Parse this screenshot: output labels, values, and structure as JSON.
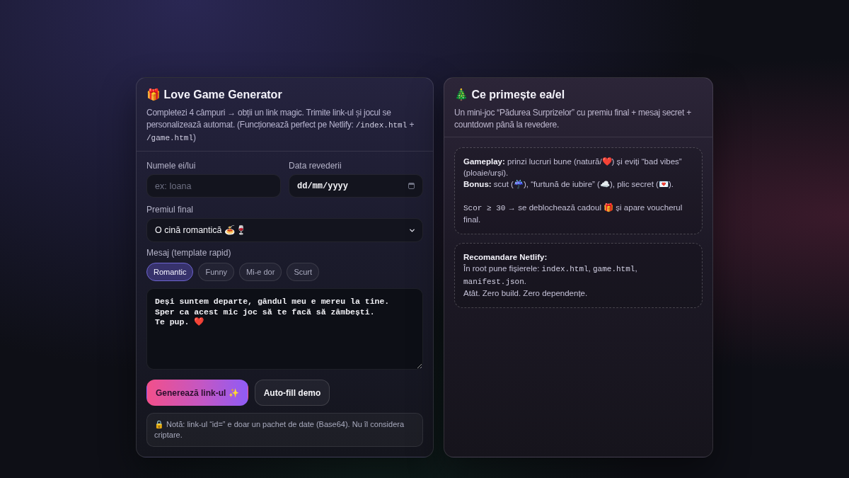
{
  "builder": {
    "title": "🎁 Love Game Generator",
    "description": [
      {
        "kind": "text",
        "text": "Completezi 4 câmpuri → obții un link magic. Trimite link-ul și jocul se personalizează automat. (Funcționează perfect pe Netlify: "
      },
      {
        "kind": "code",
        "text": "/index.html"
      },
      {
        "kind": "text",
        "text": " + "
      },
      {
        "kind": "code",
        "text": "/game.html"
      },
      {
        "kind": "text",
        "text": ")"
      }
    ],
    "fields": [
      {
        "kind": "text",
        "label": "Numele ei/lui",
        "placeholder": "ex: Ioana"
      },
      {
        "kind": "date",
        "label": "Data revederii",
        "value": "dd/mm/yyyy"
      }
    ],
    "prize": {
      "label": "Premiul final",
      "value": "O cină romantică 🍝🍷"
    },
    "templates": {
      "label": "Mesaj (template rapid)",
      "chips": [
        {
          "label": "Romantic",
          "selected": true
        },
        {
          "label": "Funny",
          "selected": false
        },
        {
          "label": "Mi-e dor",
          "selected": false
        },
        {
          "label": "Scurt",
          "selected": false
        }
      ]
    },
    "message": {
      "value": "Deși suntem departe, gândul meu e mereu la tine.\nSper ca acest mic joc să te facă să zâmbești.\nTe pup. ❤️"
    },
    "buttons": [
      {
        "kind": "primary",
        "label": "Generează link-ul ✨"
      },
      {
        "kind": "secondary",
        "label": "Auto-fill demo"
      }
    ],
    "note": "🔒 Notă: link-ul “id=” e doar un pachet de date (Base64). Nu îl considera criptare."
  },
  "summary": {
    "title": "🎄 Ce primește ea/el",
    "description": "Un mini-joc “Pădurea Surprizelor” cu premiu final + mesaj secret + countdown până la revedere.",
    "boxes": [
      {
        "sections": [
          [
            [
              {
                "kind": "bold",
                "text": "Gameplay:"
              },
              {
                "kind": "text",
                "text": " prinzi lucruri bune (natură/❤️) și eviți “bad vibes” (ploaie/urși)."
              }
            ],
            [
              {
                "kind": "bold",
                "text": "Bonus:"
              },
              {
                "kind": "text",
                "text": " scut (☔), “furtună de iubire” (☁️), plic secret (💌)."
              }
            ]
          ],
          [
            [
              {
                "kind": "code",
                "text": "Scor ≥ 30"
              },
              {
                "kind": "text",
                "text": " → se deblochează cadoul 🎁 și apare voucherul final."
              }
            ]
          ]
        ]
      },
      {
        "sections": [
          [
            [
              {
                "kind": "bold",
                "text": "Recomandare Netlify:"
              }
            ],
            [
              {
                "kind": "text",
                "text": "În root pune fișierele: "
              },
              {
                "kind": "code",
                "text": "index.html"
              },
              {
                "kind": "text",
                "text": ", "
              },
              {
                "kind": "code",
                "text": "game.html"
              },
              {
                "kind": "text",
                "text": ", "
              },
              {
                "kind": "code",
                "text": "manifest.json"
              },
              {
                "kind": "text",
                "text": "."
              }
            ],
            [
              {
                "kind": "text",
                "text": "Atât. Zero build. Zero dependențe."
              }
            ]
          ]
        ]
      }
    ]
  }
}
